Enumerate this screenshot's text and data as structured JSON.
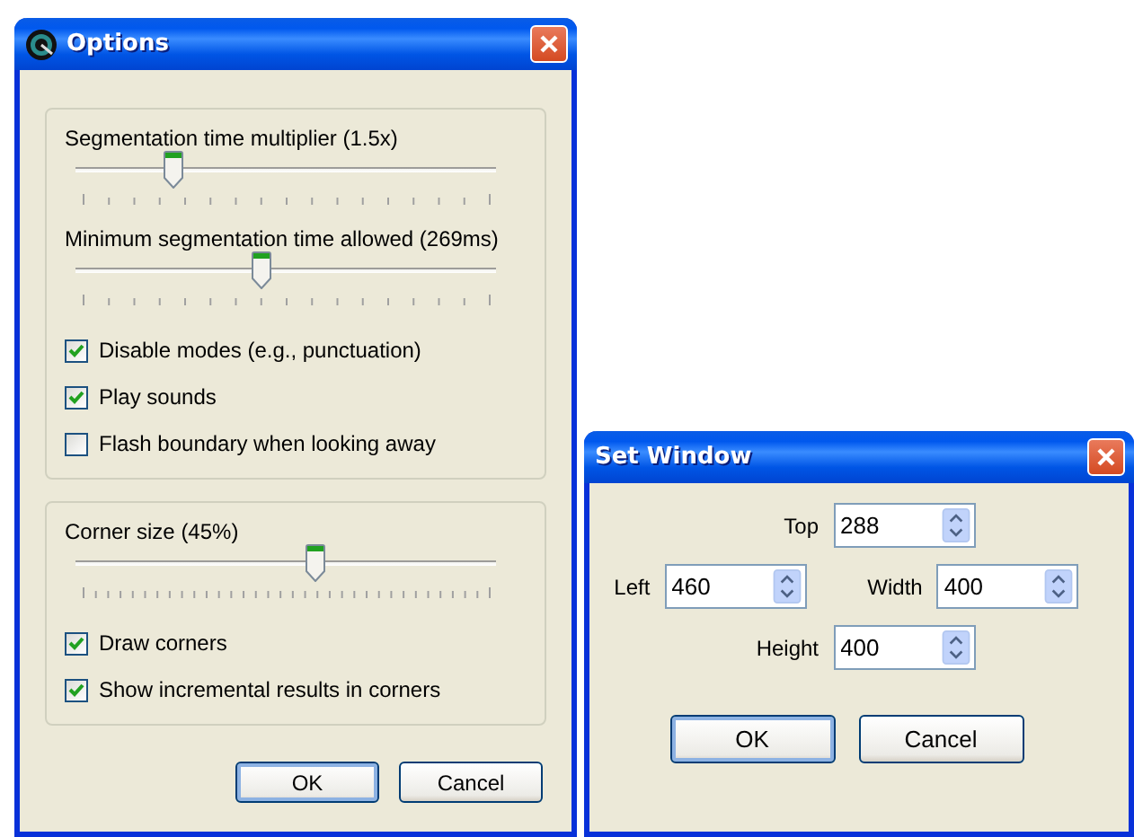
{
  "options_window": {
    "title": "Options",
    "groups": [
      {
        "sliders": [
          {
            "label": "Segmentation time multiplier (1.5x)",
            "level": 0.23
          },
          {
            "label": "Minimum segmentation time allowed (269ms)",
            "level": 0.44
          }
        ],
        "checkboxes": [
          {
            "label": "Disable modes (e.g., punctuation)",
            "checked": true
          },
          {
            "label": "Play sounds",
            "checked": true
          },
          {
            "label": "Flash boundary when looking away",
            "checked": false
          }
        ]
      },
      {
        "sliders": [
          {
            "label": "Corner size (45%)",
            "level": 0.57
          }
        ],
        "checkboxes": [
          {
            "label": "Draw corners",
            "checked": true
          },
          {
            "label": "Show incremental results in corners",
            "checked": true
          }
        ]
      }
    ],
    "buttons": [
      {
        "label": "OK",
        "default": true
      },
      {
        "label": "Cancel",
        "default": false
      }
    ]
  },
  "set_window": {
    "title": "Set Window",
    "rows": [
      {
        "fields": [
          {
            "label": "Top",
            "value": "288"
          }
        ]
      },
      {
        "fields": [
          {
            "label": "Left",
            "value": "460"
          },
          {
            "label": "Width",
            "value": "400"
          }
        ]
      },
      {
        "fields": [
          {
            "label": "Height",
            "value": "400"
          }
        ]
      }
    ],
    "buttons": [
      {
        "label": "OK",
        "default": true
      },
      {
        "label": "Cancel",
        "default": false
      }
    ]
  }
}
